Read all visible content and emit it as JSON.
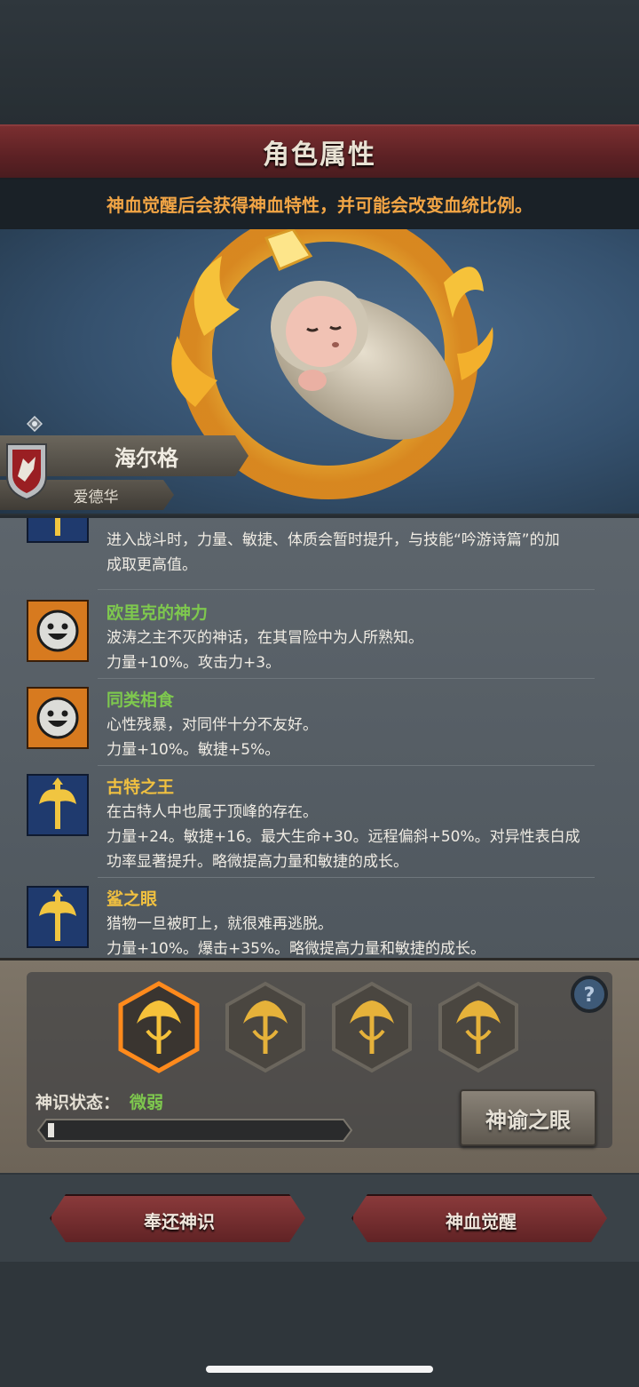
{
  "header": {
    "title": "角色属性",
    "hint": "神血觉醒后会获得神血特性，并可能会改变血统比例。"
  },
  "character": {
    "name": "海尔格",
    "lineage": "爱德华"
  },
  "traits": [
    {
      "icon": "axe-emblem-icon",
      "name": "",
      "lines": [
        "进入战斗时，力量、敏捷、体质会暂时提升，与技能“吟游诗篇”的加",
        "成取更高值。"
      ]
    },
    {
      "icon": "smiley-face-icon",
      "name": "欧里克的神力",
      "name_color": "#7ec84e",
      "lines": [
        "波涛之主不灭的神话，在其冒险中为人所熟知。",
        "力量+10%。攻击力+3。"
      ]
    },
    {
      "icon": "smiley-face-icon",
      "name": "同类相食",
      "name_color": "#7ec84e",
      "lines": [
        "心性残暴，对同伴十分不友好。",
        "力量+10%。敏捷+5%。"
      ]
    },
    {
      "icon": "axe-emblem-icon",
      "name": "古特之王",
      "name_color": "#f0c040",
      "lines": [
        "在古特人中也属于顶峰的存在。",
        "力量+24。敏捷+16。最大生命+30。远程偏斜+50%。对异性表白成",
        "功率显著提升。略微提高力量和敏捷的成长。"
      ]
    },
    {
      "icon": "axe-emblem-icon",
      "name": "鲨之眼",
      "name_color": "#f0c040",
      "lines": [
        "猎物一旦被盯上，就很难再逃脱。",
        "力量+10%。爆击+35%。略微提高力量和敏捷的成长。"
      ]
    }
  ],
  "divine_panel": {
    "slots": [
      {
        "icon": "divine-flame-crown-icon",
        "active": true
      },
      {
        "icon": "divine-flame-crown-icon",
        "active": false
      },
      {
        "icon": "divine-flame-crown-icon",
        "active": false
      },
      {
        "icon": "divine-flame-crown-icon",
        "active": false
      }
    ],
    "state_label": "神识状态：",
    "state_value": "微弱",
    "progress": 0.02,
    "oracle_button": "神谕之眼",
    "help_icon": "question-mark-icon"
  },
  "actions": {
    "return_label": "奉还神识",
    "awaken_label": "神血觉醒"
  },
  "colors": {
    "title_bar": "#5c2124",
    "hint_text": "#f2a545",
    "state_value": "#7ec84e",
    "accent_gold": "#f0c040"
  }
}
